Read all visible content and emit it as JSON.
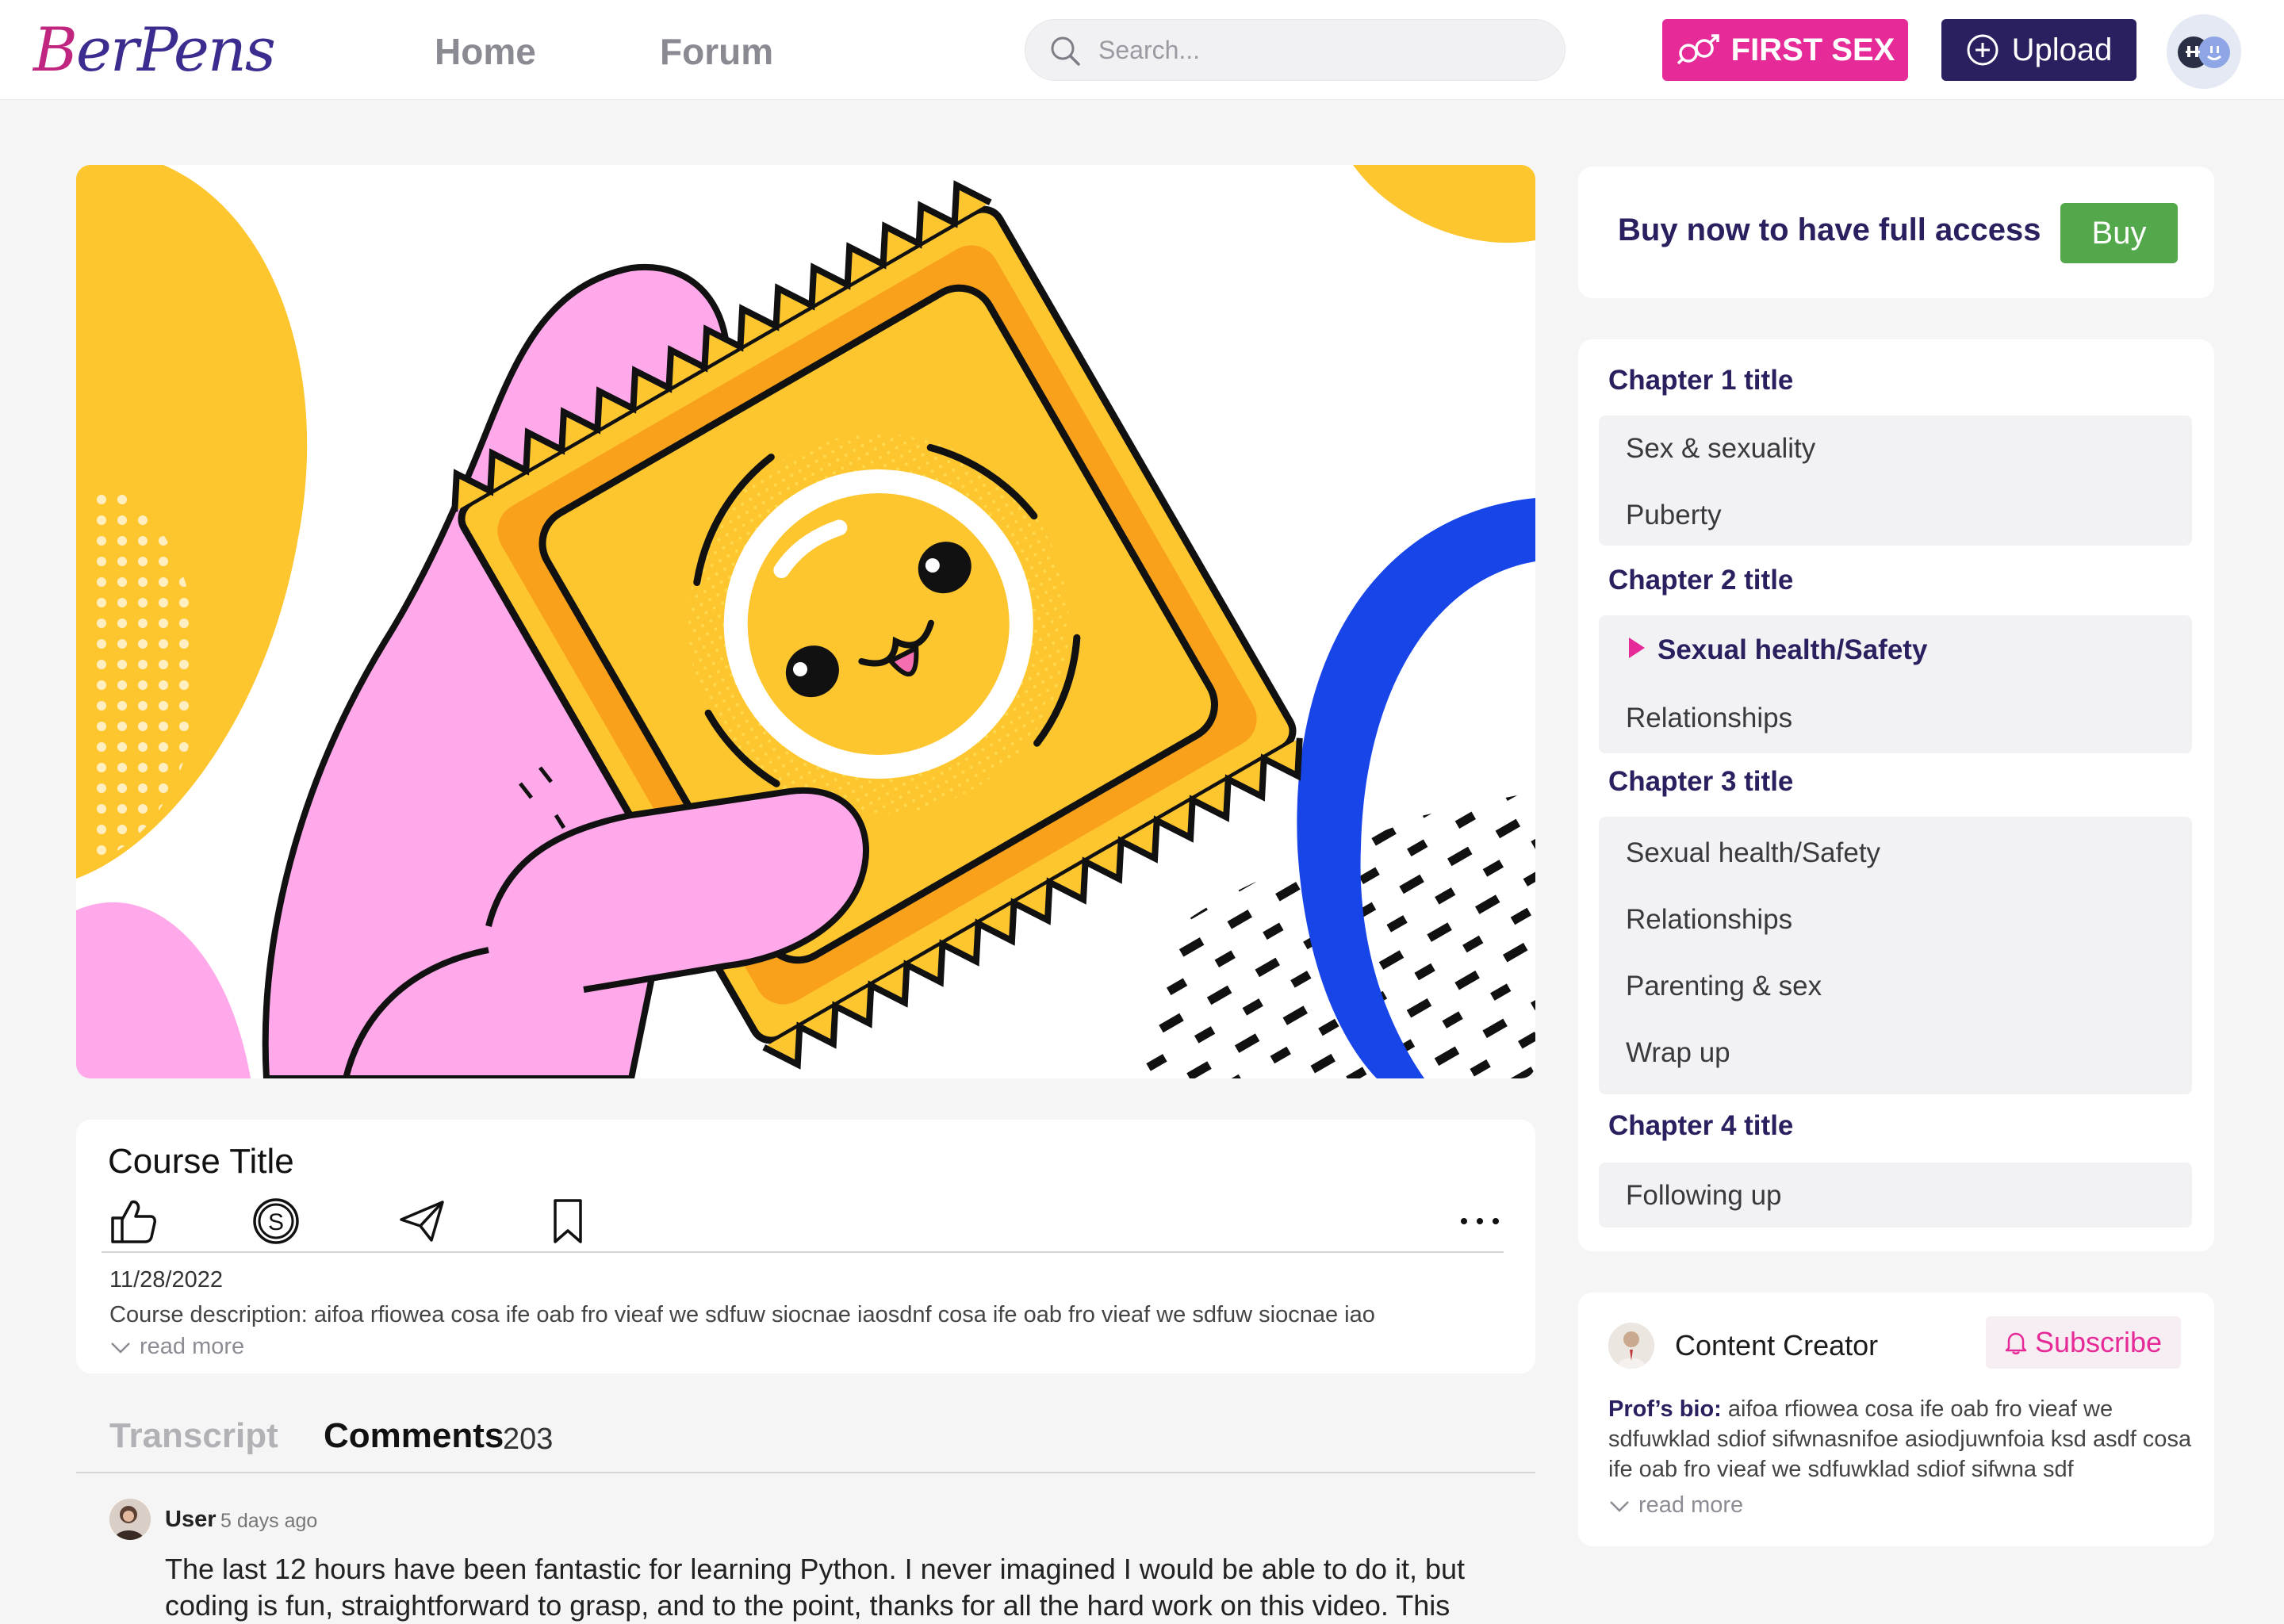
{
  "header": {
    "logo_first": "B",
    "logo_rest": "erPens",
    "nav": [
      "Home",
      "Forum"
    ],
    "search_placeholder": "Search...",
    "first_sex_label": "FIRST SEX",
    "upload_label": "Upload",
    "colors": {
      "accent_pink": "#e62a97",
      "brand_navy": "#2a205f"
    }
  },
  "course": {
    "title": "Course Title",
    "date": "11/28/2022",
    "description": "Course description: aifoa rfiowea cosa ife oab fro vieaf we sdfuw siocnae iaosdnf cosa ife oab fro vieaf we sdfuw siocnae iao",
    "read_more": "read more",
    "actions": [
      "thumbs-up-icon",
      "coin-icon",
      "share-icon",
      "bookmark-icon",
      "more-icon"
    ]
  },
  "tabs": {
    "transcript": "Transcript",
    "comments": "Comments",
    "comments_count": "203"
  },
  "comment": {
    "user": "User",
    "time": "5 days ago",
    "text": "The last 12 hours have been fantastic for learning Python. I never imagined I would be able to do it, but coding is fun, straightforward to grasp, and to the point, thanks for all the hard work on this video. This"
  },
  "buy": {
    "text": "Buy now to have full access",
    "button": "Buy",
    "button_color": "#52a84a"
  },
  "chapters": [
    {
      "title": "Chapter 1 title",
      "items": [
        "Sex & sexuality",
        "Puberty"
      ]
    },
    {
      "title": "Chapter 2 title",
      "items": [
        "Sexual health/Safety",
        "Relationships"
      ],
      "active_item": 0
    },
    {
      "title": "Chapter 3 title",
      "items": [
        "Sexual health/Safety",
        "Relationships",
        "Parenting & sex",
        "Wrap up"
      ]
    },
    {
      "title": "Chapter 4 title",
      "items": [
        "Following up"
      ]
    }
  ],
  "creator": {
    "name": "Content Creator",
    "subscribe": "Subscribe",
    "bio_label": "Prof’s bio:",
    "bio": " aifoa rfiowea cosa ife oab fro vieaf we sdfuwklad sdiof sifwnasnifoe asiodjuwnfoia ksd asdf cosa ife oab fro vieaf we sdfuwklad sdiof sifwna sdf",
    "read_more": "read more"
  }
}
